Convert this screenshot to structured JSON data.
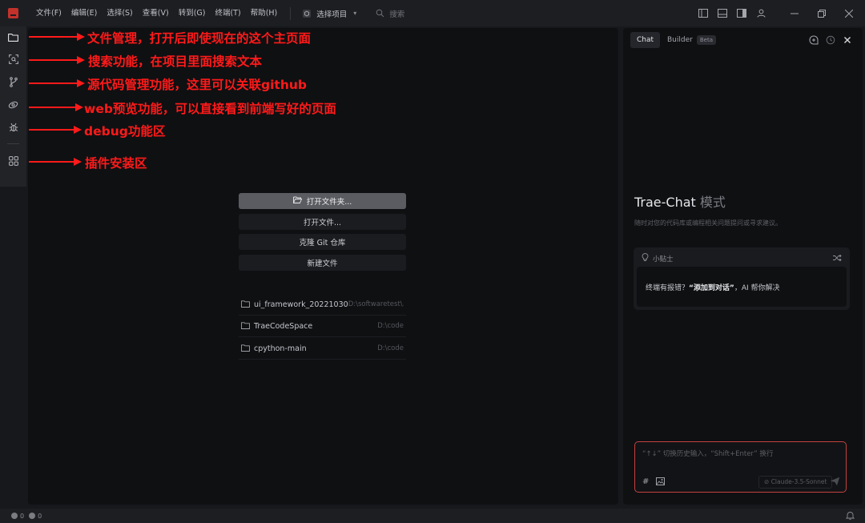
{
  "menu": [
    "文件(F)",
    "编辑(E)",
    "选择(S)",
    "查看(V)",
    "转到(G)",
    "终端(T)",
    "帮助(H)"
  ],
  "project_select": {
    "label": "选择项目",
    "icon": "cube-icon"
  },
  "search": {
    "placeholder": "搜索"
  },
  "titlebar_icons": [
    "layout-left-icon",
    "layout-bottom-icon",
    "layout-right-icon",
    "account-icon"
  ],
  "window_controls": [
    "minimize-icon",
    "restore-icon",
    "close-icon"
  ],
  "activity_bar": [
    {
      "name": "explorer",
      "icon": "folder-icon"
    },
    {
      "name": "search",
      "icon": "scan-search-icon"
    },
    {
      "name": "source-control",
      "icon": "git-branch-icon"
    },
    {
      "name": "web-preview",
      "icon": "link-preview-icon"
    },
    {
      "name": "debug",
      "icon": "bug-icon"
    },
    {
      "name": "extensions",
      "icon": "grid-icon"
    }
  ],
  "welcome": {
    "actions": [
      "打开文件夹...",
      "打开文件...",
      "克隆 Git 仓库",
      "新建文件"
    ],
    "recent": [
      {
        "name": "ui_framework_20221030",
        "path": "D:\\softwaretest\\..."
      },
      {
        "name": "TraeCodeSpace",
        "path": "D:\\code"
      },
      {
        "name": "cpython-main",
        "path": "D:\\code"
      }
    ]
  },
  "chat": {
    "tabs": {
      "chat": "Chat",
      "builder": "Builder",
      "beta": "Beta"
    },
    "title": "Trae-Chat",
    "title_suffix": "模式",
    "subtitle": "随时对您的代码库或编程相关问题提问或寻求建议。",
    "tips": {
      "header": "小贴士",
      "text_before": "终端有报错？",
      "text_bold": "“添加到对话”",
      "text_after": "，AI 帮你解决"
    },
    "input": {
      "placeholder": "“↑↓” 切换历史输入，“Shift+Enter” 换行",
      "hash": "#",
      "model": "Claude-3.5-Sonnet"
    }
  },
  "status": {
    "errors": "0",
    "warnings": "0"
  },
  "annotations": [
    "文件管理，打开后即使现在的这个主页面",
    "搜索功能，在项目里面搜索文本",
    "源代码管理功能，这里可以关联github",
    "web预览功能，可以直接看到前端写好的页面",
    "debug功能区",
    "插件安装区"
  ],
  "colors": {
    "annotation_red": "#ff1a1a",
    "primary_button": "#5b5c61",
    "input_border": "#c4423f",
    "logo_red": "#c2322b"
  }
}
